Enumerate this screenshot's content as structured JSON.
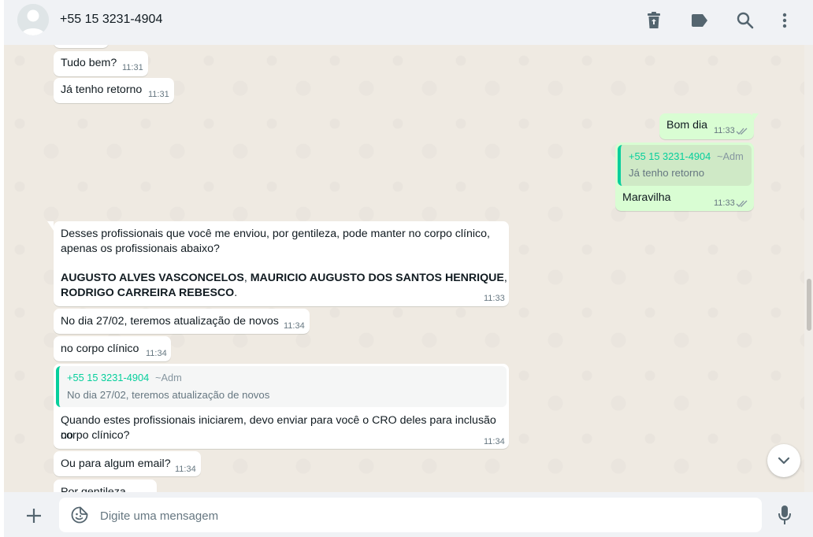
{
  "header": {
    "contact_name": "+55 15 3231-4904",
    "icons": [
      "delete-icon",
      "label-icon",
      "search-icon",
      "menu-icon"
    ]
  },
  "messages": [
    {
      "dir": "in",
      "text": "Tudo bem?",
      "time": "11:31"
    },
    {
      "dir": "in",
      "text": "Já tenho retorno",
      "time": "11:31"
    },
    {
      "dir": "out",
      "text": "Bom dia",
      "time": "11:33",
      "status": "read"
    },
    {
      "dir": "out",
      "quote_author": "+55 15 3231-4904",
      "quote_tag": "~Adm",
      "quote_text": "Já tenho retorno"
    },
    {
      "dir": "out",
      "text": "Maravilha",
      "time": "11:33",
      "status": "read"
    },
    {
      "dir": "in",
      "text_line1": "Desses profissionais que você me enviou, por gentileza, pode manter no corpo clínico,",
      "text_line2": "apenas os profissionais abaixo?",
      "bold1": "AUGUSTO ALVES VASCONCELOS",
      "sep1": ", ",
      "bold2": "MAURICIO AUGUSTO DOS SANTOS HENRIQUE",
      "sep2": ",",
      "bold3": "RODRIGO CARREIRA REBESCO",
      "end": ".",
      "time": "11:33"
    },
    {
      "dir": "in",
      "text": "No dia 27/02, teremos atualização de novos",
      "time": "11:34"
    },
    {
      "dir": "in",
      "text": "no corpo clínico",
      "time": "11:34"
    },
    {
      "dir": "in",
      "quote_author": "+55 15 3231-4904",
      "quote_tag": "~Adm",
      "quote_text": "No dia 27/02, teremos atualização de novos",
      "text_line1": "Quando estes profissionais iniciarem, devo enviar para você o CRO deles para inclusão no",
      "text_line2": "corpo clínico?",
      "time": "11:34"
    },
    {
      "dir": "in",
      "text": "Ou para algum email?",
      "time": "11:34"
    },
    {
      "dir": "in",
      "text": "Por gentileza"
    }
  ],
  "footer": {
    "placeholder": "Digite uma mensagem"
  },
  "colors": {
    "incoming": "#ffffff",
    "outgoing": "#d9fdd3",
    "accent": "#06cf9c",
    "read_ticks": "#53bdeb",
    "chat_bg": "#efeae2"
  }
}
